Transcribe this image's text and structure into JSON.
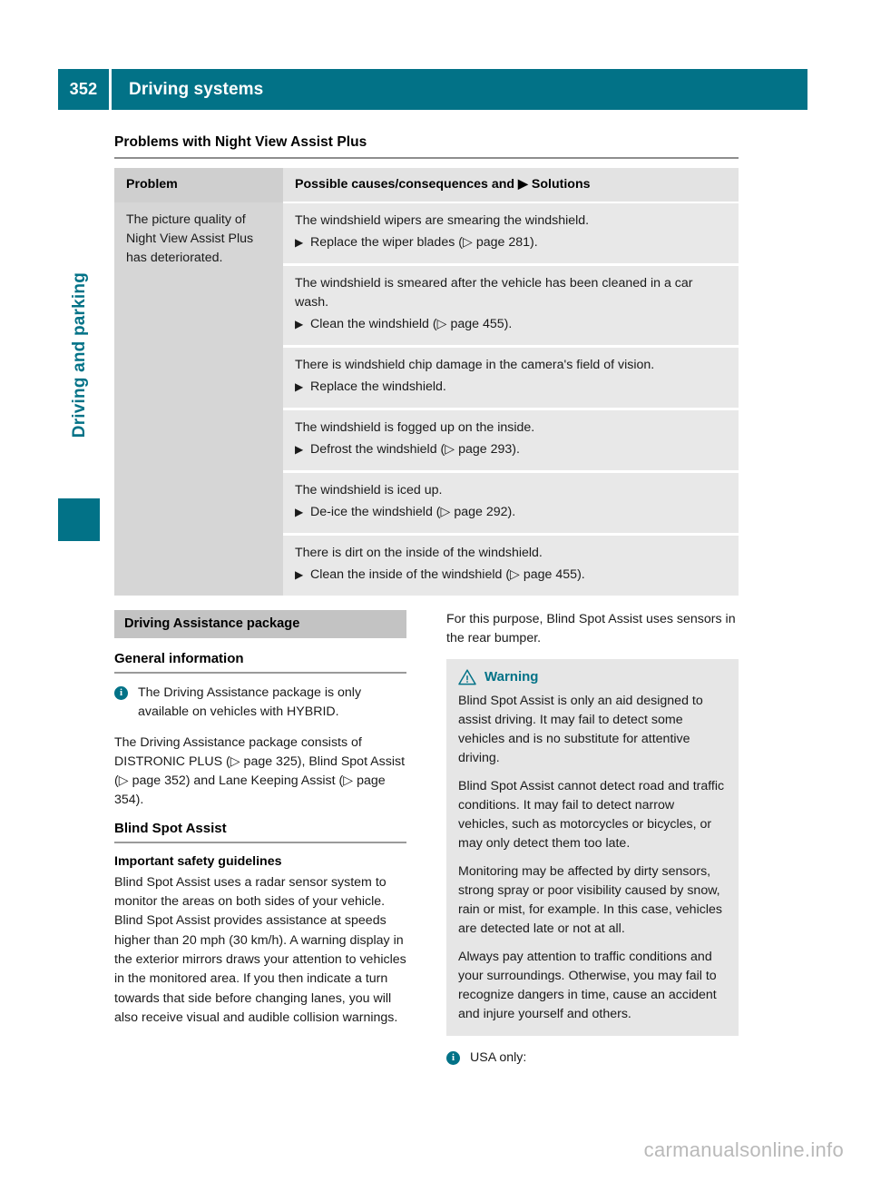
{
  "header": {
    "page_number": "352",
    "title": "Driving systems"
  },
  "side_tab": {
    "label": "Driving and parking"
  },
  "table_section": {
    "title": "Problems with Night View Assist Plus",
    "columns": {
      "problem": "Problem",
      "causes": "Possible causes/consequences and ▶ Solutions"
    },
    "problem_text": "The picture quality of Night View Assist Plus has deteriorated.",
    "rows": [
      {
        "cause": "The windshield wipers are smearing the windshield.",
        "solution": "Replace the wiper blades (▷ page 281)."
      },
      {
        "cause": "The windshield is smeared after the vehicle has been cleaned in a car wash.",
        "solution": "Clean the windshield (▷ page 455)."
      },
      {
        "cause": "There is windshield chip damage in the camera's field of vision.",
        "solution": "Replace the windshield."
      },
      {
        "cause": "The windshield is fogged up on the inside.",
        "solution": "Defrost the windshield (▷ page 293)."
      },
      {
        "cause": "The windshield is iced up.",
        "solution": "De-ice the windshield (▷ page 292)."
      },
      {
        "cause": "There is dirt on the inside of the windshield.",
        "solution": "Clean the inside of the windshield (▷ page 455)."
      }
    ],
    "bullet_solid": "▶",
    "bullet_hollow": "▷"
  },
  "left_column": {
    "package_bar": "Driving Assistance package",
    "general_information_head": "General information",
    "info_note": "The Driving Assistance package is only available on vehicles with HYBRID.",
    "general_paragraph": "The Driving Assistance package consists of DISTRONIC PLUS (▷ page 325), Blind Spot Assist (▷ page 352) and Lane Keeping Assist (▷ page 354).",
    "blind_spot_head": "Blind Spot Assist",
    "safety_head": "Important safety guidelines",
    "safety_paragraph": "Blind Spot Assist uses a radar sensor system to monitor the areas on both sides of your vehicle. Blind Spot Assist provides assistance at speeds higher than 20 mph (30 km/h). A warning display in the exterior mirrors draws your attention to vehicles in the monitored area. If you then indicate a turn towards that side before changing lanes, you will also receive visual and audible collision warnings."
  },
  "right_column": {
    "intro_paragraph": "For this purpose, Blind Spot Assist uses sensors in the rear bumper.",
    "warning": {
      "label": "Warning",
      "paragraphs": [
        "Blind Spot Assist is only an aid designed to assist driving. It may fail to detect some vehicles and is no substitute for attentive driving.",
        "Blind Spot Assist cannot detect road and traffic conditions. It may fail to detect narrow vehicles, such as motorcycles or bicycles, or may only detect them too late.",
        "Monitoring may be affected by dirty sensors, strong spray or poor visibility caused by snow, rain or mist, for example. In this case, vehicles are detected late or not at all.",
        "Always pay attention to traffic conditions and your surroundings. Otherwise, you may fail to recognize dangers in time, cause an accident and injure yourself and others."
      ]
    },
    "usa_note": "USA only:"
  },
  "watermark": "carmanualsonline.info",
  "colors": {
    "brand_teal": "#027287",
    "header_bg": "#027287",
    "table_header_left": "#cfcfcf",
    "table_header_right": "#e3e3e3",
    "problem_cell_bg": "#d6d6d6",
    "cause_cell_bg": "#e8e8e8",
    "package_bar_bg": "#c3c3c3",
    "warning_box_bg": "#e6e6e6",
    "watermark_color": "#b9b9b9"
  },
  "icons": {
    "info": "info-circle-icon",
    "warning": "warning-triangle-icon"
  }
}
